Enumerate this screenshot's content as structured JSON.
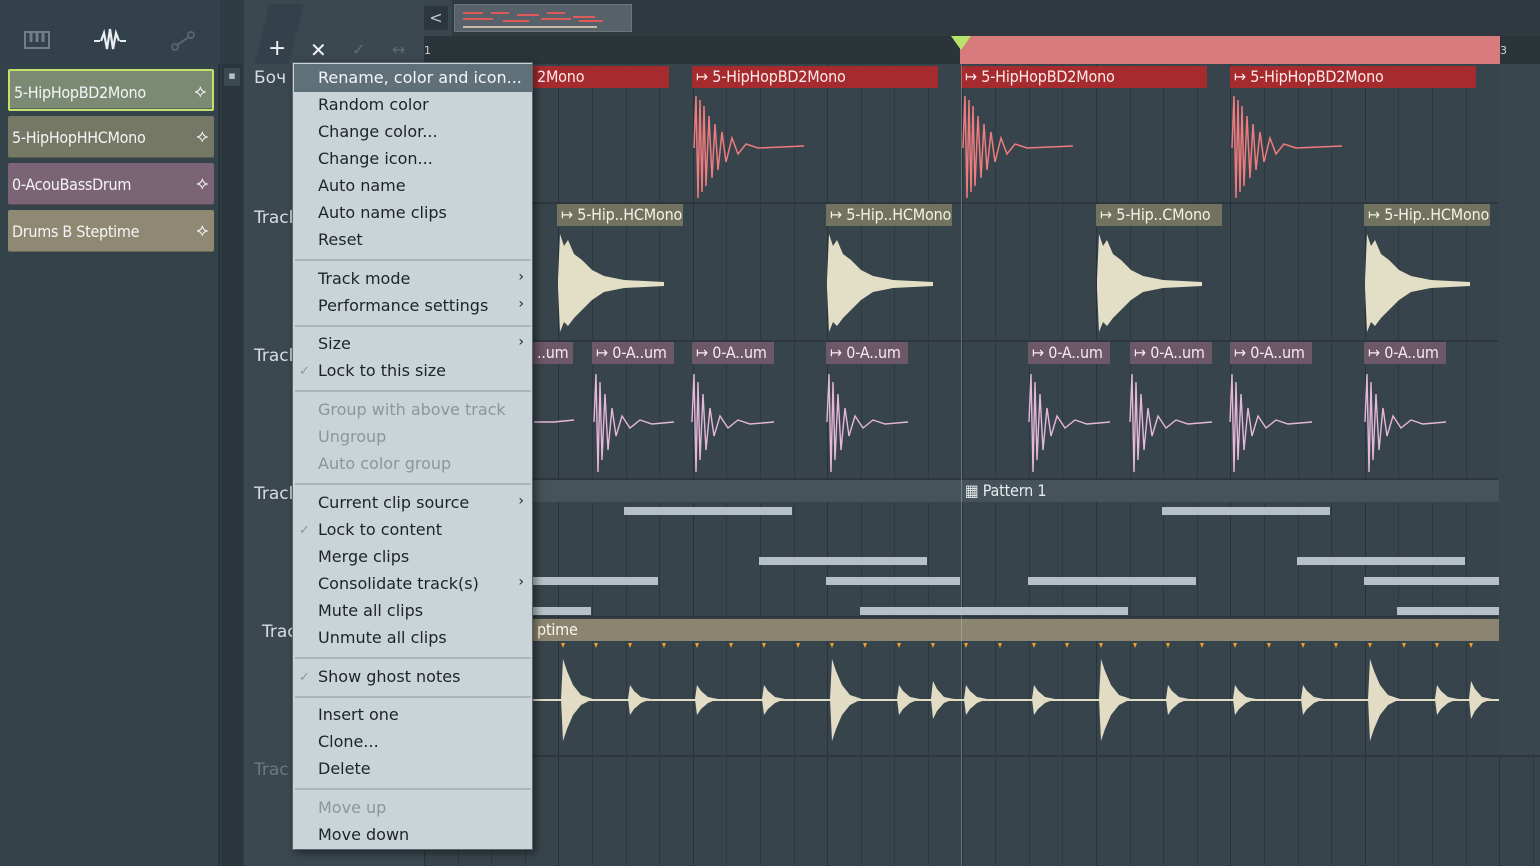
{
  "browser": {
    "items": [
      {
        "label": "5-HipHopBD2Mono",
        "color": "#7c8a74",
        "selected": true
      },
      {
        "label": "5-HipHopHHCMono",
        "color": "#767866"
      },
      {
        "label": "0-AcouBassDrum",
        "color": "#7b6474"
      },
      {
        "label": "Drums B Steptime",
        "color": "#8f8872"
      }
    ],
    "toolbar_icons": [
      "piano-roll-icon",
      "waveform-icon",
      "automation-icon"
    ]
  },
  "header": {
    "add_glyph": "+",
    "close_glyph": "✕",
    "back_glyph": "<",
    "ruler_start": "1",
    "ruler_mark": "3"
  },
  "tracks": {
    "labels": [
      "Боч",
      "Tracl",
      "Tracl",
      "Tracl",
      "Trac",
      "Trac"
    ]
  },
  "clips": {
    "bd": [
      "2Mono",
      "5-HipHopBD2Mono",
      "5-HipHopBD2Mono",
      "5-HipHopBD2Mono"
    ],
    "hh": [
      "5-Hip..HCMono",
      "5-Hip..HCMono",
      "5-Hip..CMono",
      "5-Hip..HCMono"
    ],
    "ac": [
      "..um",
      "0-A..um",
      "0-A..um",
      "0-A..um",
      "0-A..um",
      "0-A..um",
      "0-A..um",
      "0-A..um"
    ],
    "pattern": "Pattern 1",
    "drum": "ptime"
  },
  "menu": {
    "items": [
      {
        "label": "Rename, color and icon...",
        "state": "highlighted"
      },
      {
        "label": "Random color"
      },
      {
        "label": "Change color..."
      },
      {
        "label": "Change icon..."
      },
      {
        "label": "Auto name"
      },
      {
        "label": "Auto name clips"
      },
      {
        "label": "Reset"
      },
      {
        "label": "Track mode",
        "submenu": true
      },
      {
        "label": "Performance settings",
        "submenu": true
      },
      {
        "label": "Size",
        "submenu": true
      },
      {
        "label": "Lock to this size",
        "checked": true
      },
      {
        "label": "Group with above track",
        "disabled": true
      },
      {
        "label": "Ungroup",
        "disabled": true
      },
      {
        "label": "Auto color group",
        "disabled": true
      },
      {
        "label": "Current clip source",
        "submenu": true
      },
      {
        "label": "Lock to content",
        "checked": true
      },
      {
        "label": "Merge clips"
      },
      {
        "label": "Consolidate track(s)",
        "submenu": true
      },
      {
        "label": "Mute all clips"
      },
      {
        "label": "Unmute all clips"
      },
      {
        "label": "Show ghost notes",
        "checked": true
      },
      {
        "label": "Insert one"
      },
      {
        "label": "Clone..."
      },
      {
        "label": "Delete"
      },
      {
        "label": "Move up",
        "disabled": true
      },
      {
        "label": "Move down"
      }
    ],
    "submenu_glyph": "›",
    "check_glyph": "✓"
  }
}
